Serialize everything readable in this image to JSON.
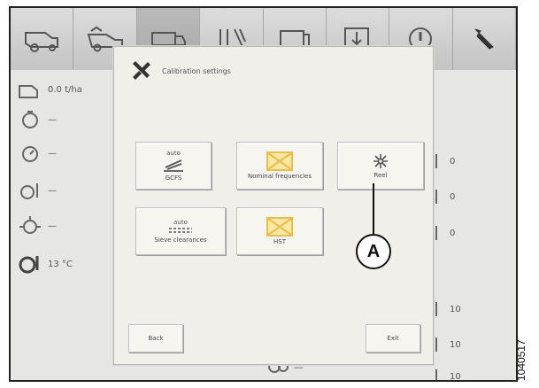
{
  "topbar": {
    "tabs": [
      {
        "icon": "combine-icon"
      },
      {
        "icon": "harvester-icon"
      },
      {
        "icon": "header-icon",
        "active": true
      },
      {
        "icon": "grain-icon"
      },
      {
        "icon": "monitor-icon"
      },
      {
        "icon": "download-icon"
      },
      {
        "icon": "warning-icon"
      },
      {
        "icon": "wrench-icon"
      }
    ]
  },
  "sidebar": {
    "rows": [
      {
        "icon": "yield-icon",
        "value": "0.0 t/ha"
      },
      {
        "icon": "sensor-icon",
        "value": "—"
      },
      {
        "icon": "sensor-2-icon",
        "value": "—"
      },
      {
        "icon": "level-icon",
        "value": "—"
      },
      {
        "icon": "engine-icon",
        "value": "—"
      },
      {
        "icon": "temperature-icon",
        "value": "13 °C"
      }
    ]
  },
  "rightcol": {
    "rows": [
      {
        "value": "0"
      },
      {
        "value": "0"
      },
      {
        "value": "0"
      },
      {
        "value": "10"
      },
      {
        "value": "10"
      },
      {
        "value": "10"
      }
    ]
  },
  "bottom": {
    "value": "—"
  },
  "dialog": {
    "title": "Calibration settings",
    "buttons": [
      {
        "id": "gcfs",
        "top_label": "auto",
        "label": "GCFS"
      },
      {
        "id": "nominal",
        "label": "Nominal frequencies"
      },
      {
        "id": "reel",
        "label": "Reel"
      },
      {
        "id": "sieve",
        "top_label": "auto",
        "label": "Sieve clearances"
      },
      {
        "id": "hst",
        "label": "HST"
      }
    ],
    "back_label": "Back",
    "exit_label": "Exit"
  },
  "callout": {
    "label": "A"
  },
  "document_number": "1040517",
  "colors": {
    "placeholder_border": "#e6c04a",
    "placeholder_fill": "#fbe6a6",
    "frame": "#222222"
  }
}
